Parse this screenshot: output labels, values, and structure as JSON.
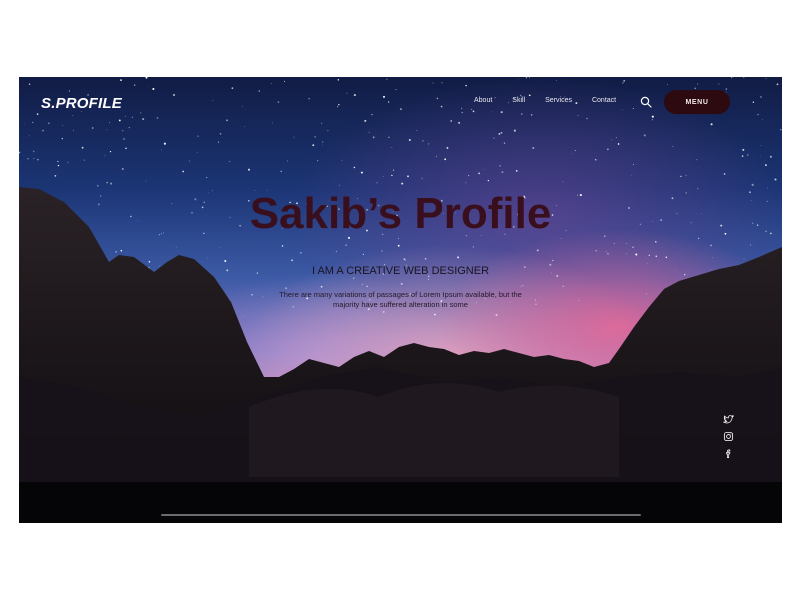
{
  "brand": {
    "logo": "S.PROFILE"
  },
  "nav": {
    "items": [
      {
        "label": "About"
      },
      {
        "label": "Skill"
      },
      {
        "label": "Services"
      },
      {
        "label": "Contact"
      }
    ],
    "menu_label": "MENU"
  },
  "hero": {
    "title": "Sakib’s Profile",
    "subtitle": "I AM A CREATIVE WEB DESIGNER",
    "description": "There are many variations of passages of Lorem Ipsum available, but the majority have suffered alteration in some"
  },
  "social": [
    "twitter-icon",
    "instagram-icon",
    "facebook-icon"
  ],
  "colors": {
    "menu_button": "#2c0a10",
    "title": "#3a0f1d",
    "text_light": "#ffffff"
  }
}
